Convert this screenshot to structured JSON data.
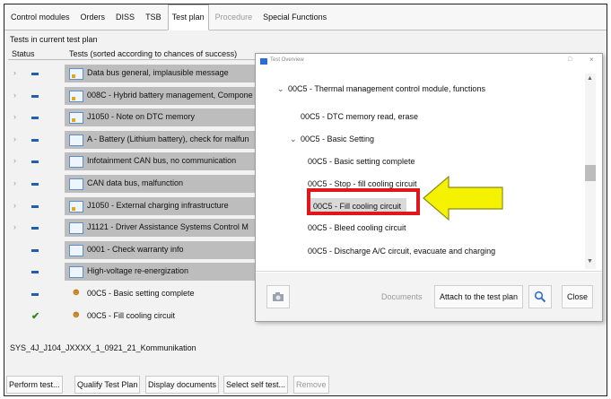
{
  "tabs": [
    {
      "label": "Control modules",
      "state": "normal"
    },
    {
      "label": "Orders",
      "state": "normal"
    },
    {
      "label": "DISS",
      "state": "normal"
    },
    {
      "label": "TSB",
      "state": "normal"
    },
    {
      "label": "Test plan",
      "state": "active"
    },
    {
      "label": "Procedure",
      "state": "disabled"
    },
    {
      "label": "Special Functions",
      "state": "normal"
    }
  ],
  "section_title": "Tests in current test plan",
  "columns": {
    "status": "Status",
    "tests": "Tests (sorted according to chances of success)"
  },
  "rows": [
    {
      "text": "Data bus general, implausible message",
      "icon": "test-doc-warning-icon",
      "status": "pending",
      "selected": true,
      "expandable": true
    },
    {
      "text": "008C - Hybrid battery management, Compone",
      "icon": "test-doc-warning-icon",
      "status": "pending",
      "selected": true,
      "expandable": true
    },
    {
      "text": "J1050 - Note on DTC memory",
      "icon": "test-doc-warning-icon",
      "status": "pending",
      "selected": true,
      "expandable": true
    },
    {
      "text": "A - Battery  (Lithium battery), check for malfun",
      "icon": "test-doc-icon",
      "status": "pending",
      "selected": true,
      "expandable": true
    },
    {
      "text": "Infotainment CAN bus, no communication",
      "icon": "test-doc-icon",
      "status": "pending",
      "selected": true,
      "expandable": true
    },
    {
      "text": "CAN data bus, malfunction",
      "icon": "test-doc-icon",
      "status": "pending",
      "selected": true,
      "expandable": true
    },
    {
      "text": "J1050 - External charging infrastructure",
      "icon": "test-doc-warning-icon",
      "status": "pending",
      "selected": true,
      "expandable": true
    },
    {
      "text": "J1121 - Driver Assistance Systems Control M",
      "icon": "test-doc-icon",
      "status": "pending",
      "selected": true,
      "expandable": true
    },
    {
      "text": "0001 - Check warranty info",
      "icon": "test-doc-icon",
      "status": "pending",
      "selected": true,
      "expandable": false
    },
    {
      "text": "High-voltage re-energization",
      "icon": "test-doc-icon",
      "status": "pending",
      "selected": true,
      "expandable": false
    },
    {
      "text": "00C5 - Basic setting complete",
      "icon": "person-icon",
      "status": "pending",
      "selected": false,
      "expandable": false
    },
    {
      "text": "00C5 - Fill cooling circuit",
      "icon": "person-icon",
      "status": "done",
      "selected": false,
      "expandable": false
    }
  ],
  "status_line": "SYS_4J_J104_JXXXX_1_0921_21_Kommunikation",
  "bottom_buttons": [
    {
      "label": "Perform test...",
      "enabled": true
    },
    {
      "label": "Qualify Test Plan",
      "enabled": true
    },
    {
      "label": "Display documents",
      "enabled": true
    },
    {
      "label": "Select self test...",
      "enabled": true
    },
    {
      "label": "Remove",
      "enabled": false
    }
  ],
  "dialog": {
    "title": "Test Overview",
    "min_symbol": "□",
    "close_symbol": "×",
    "tree": [
      {
        "text": "00C5 - Thermal management control module, functions",
        "arrow": "⌄",
        "level": 0
      },
      {
        "text": "00C5 - DTC memory read, erase",
        "arrow": "",
        "level": 1
      },
      {
        "text": "00C5 - Basic Setting",
        "arrow": "⌄",
        "level": 1
      },
      {
        "text": "00C5 - Basic setting complete",
        "arrow": "",
        "level": 2
      },
      {
        "text": "00C5 - Stop - fill cooling circuit",
        "arrow": "",
        "level": 2
      },
      {
        "text": "00C5 - Fill cooling circuit",
        "arrow": "",
        "level": 2,
        "selected": true
      },
      {
        "text": "00C5 - Bleed cooling circuit",
        "arrow": "",
        "level": 2
      },
      {
        "text": "00C5 - Discharge A/C circuit, evacuate and charging",
        "arrow": "",
        "level": 2
      }
    ],
    "buttons": {
      "documents": "Documents",
      "attach": "Attach to the test plan",
      "close": "Close"
    }
  },
  "colors": {
    "highlight": "#e0161c",
    "arrow": "#f5f200",
    "selection": "#bdbdbd"
  }
}
